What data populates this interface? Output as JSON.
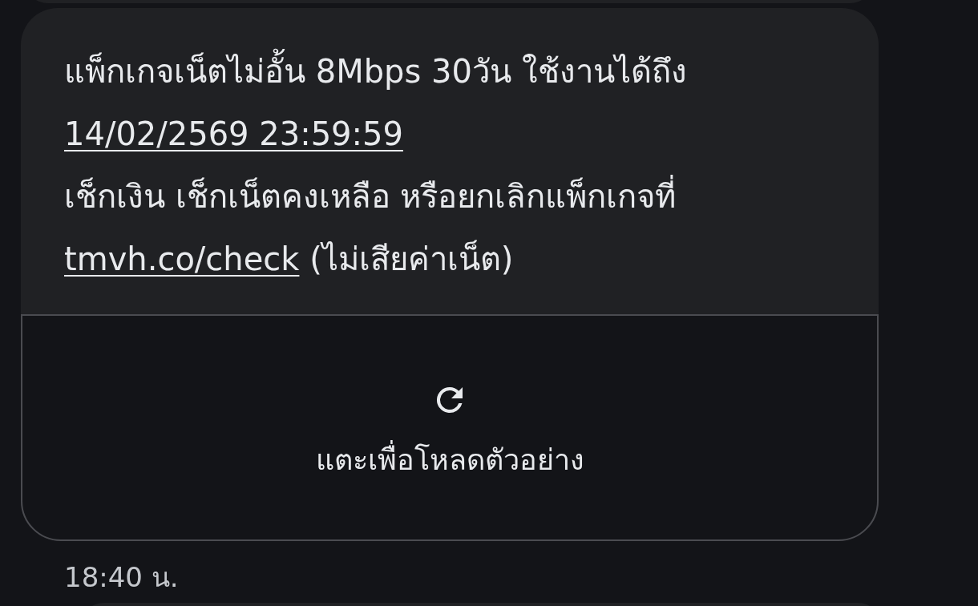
{
  "message": {
    "parts": [
      {
        "kind": "text",
        "text": "แพ็กเกจเน็ตไม่อั้น 8Mbps 30วัน ใช้งานได้ถึง\n"
      },
      {
        "kind": "link",
        "text": "14/02/2569 23:59:59"
      },
      {
        "kind": "text",
        "text": "\nเช็กเงิน เช็กเน็ตคงเหลือ หรือยกเลิกแพ็กเกจที่\n"
      },
      {
        "kind": "link",
        "text": "tmvh.co/check"
      },
      {
        "kind": "text",
        "text": " (ไม่เสียค่าเน็ต)"
      }
    ],
    "preview": {
      "label": "แตะเพื่อโหลดตัวอย่าง"
    },
    "time": "18:40 น."
  }
}
